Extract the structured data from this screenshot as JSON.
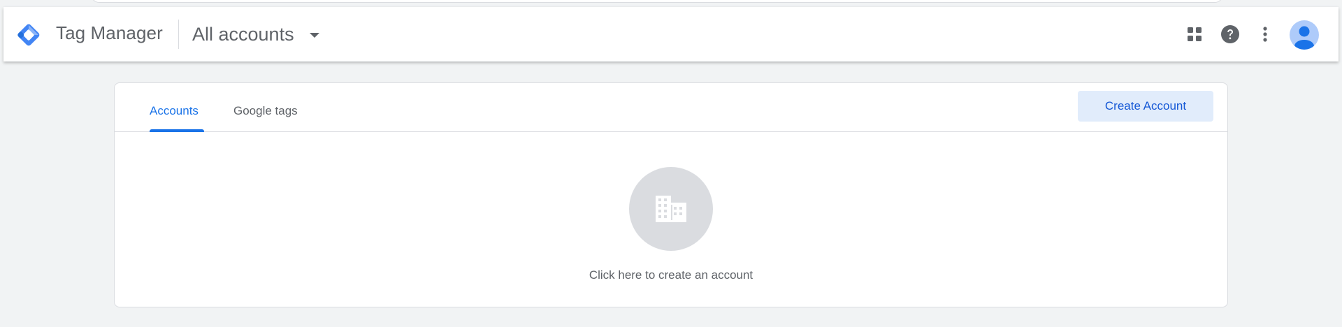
{
  "header": {
    "product_name": "Tag Manager",
    "account_switcher_label": "All accounts",
    "icons": {
      "logo": "tag-manager-logo-icon",
      "apps": "apps-grid-icon",
      "help": "help-circle-icon",
      "more": "more-vert-icon",
      "avatar": "account-avatar-icon"
    }
  },
  "tabs": [
    {
      "label": "Accounts",
      "active": true
    },
    {
      "label": "Google tags",
      "active": false
    }
  ],
  "create_account_label": "Create Account",
  "empty_state": {
    "icon": "building-icon",
    "text": "Click here to create an account"
  },
  "colors": {
    "accent": "#1a73e8",
    "button_bg": "#e1ecfb",
    "background": "#f1f3f4"
  }
}
